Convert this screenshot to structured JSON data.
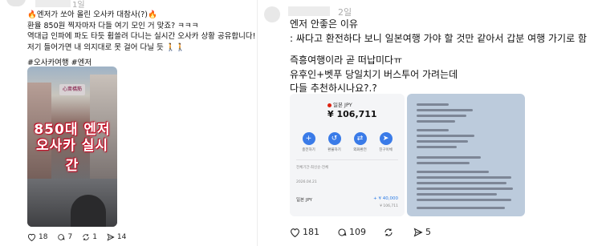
{
  "left_post": {
    "time": "1일",
    "lines": [
      "엔저가 쏘아 올린 오사카 대참사(?)",
      "환율 850원 찍자마자 다들 여기 모인 거 맞죠? ㅋㅋㅋ",
      "역대급 인파에 파도 타듯 휩쓸려 다니는 실시간 오사카 상황 공유합니다!",
      "저기 들어가면 내 의지대로 못 걸어 다닐 듯 🚶🚶"
    ],
    "hashtags": "#오사카여행 #엔저",
    "photo": {
      "overlay_line1": "850대 엔저",
      "overlay_line2": "오사카 실시간",
      "sign_text": "心斎橋筋"
    },
    "actions": {
      "likes": "18",
      "comments": "7",
      "reposts": "1",
      "shares": "14"
    }
  },
  "right_post": {
    "time": "2일",
    "lines": [
      "엔저 안좋은 이유",
      ": 싸다고 환전하다 보니 일본여행 가야 할 것만 같아서 갑분 여행 가기로 함",
      "즉흥여행이라 곧 떠납미다ㅠ",
      "유후인+벳푸 당일치기 버스투어 가려는데",
      "다들 추천하시나요?.?"
    ],
    "card1": {
      "currency": "일본 JPY",
      "balance": "¥ 106,711",
      "buttons": [
        "충전하기",
        "환불하기",
        "외화환전",
        "친구이체"
      ],
      "history_label": "전체기간·최신순·전체",
      "date_label": "2026.04.21",
      "row_label": "일본 JPY",
      "row_amount": "+ ¥ 40,000",
      "row_balance": "¥ 106,711"
    },
    "actions": {
      "likes": "181",
      "comments": "109",
      "reposts": "",
      "shares": "5"
    }
  },
  "colors": {
    "flame": "#e8680c",
    "accent_blue": "#3a7be8",
    "muted": "#aaaaaa"
  }
}
